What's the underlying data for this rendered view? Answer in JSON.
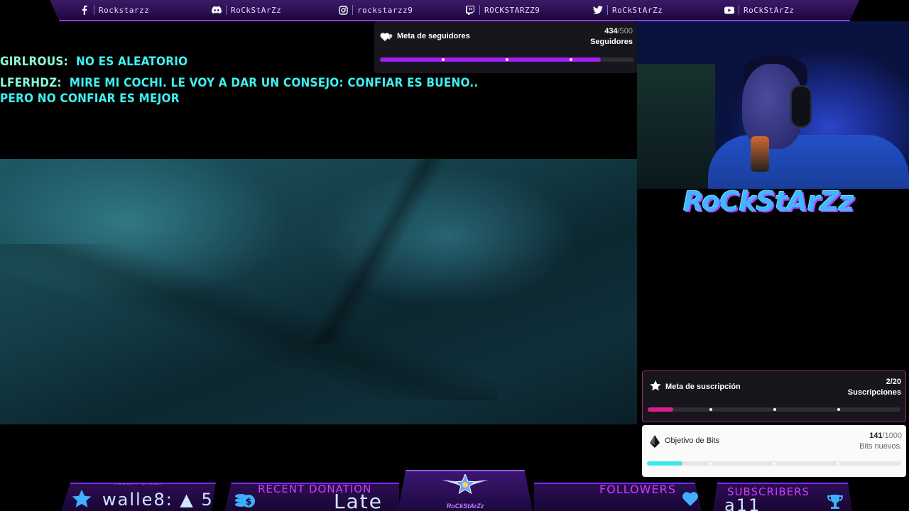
{
  "social": [
    {
      "icon": "facebook-icon",
      "handle": "Rockstarzz"
    },
    {
      "icon": "discord-icon",
      "handle": "RoCkStArZz"
    },
    {
      "icon": "instagram-icon",
      "handle": "rockstarzz9"
    },
    {
      "icon": "twitch-icon",
      "handle": "ROCKSTARZZ9"
    },
    {
      "icon": "twitter-icon",
      "handle": "RoCkStArZz"
    },
    {
      "icon": "youtube-icon",
      "handle": "RoCkStArZz"
    }
  ],
  "chat": [
    {
      "user": "GIRLROUS:",
      "message": "NO ES ALEATORIO"
    },
    {
      "user": "LFERHDZ:",
      "message": "MIRE MI COCHI. LE VOY A DAR UN CONSEJO: CONFIAR ES BUENO.."
    },
    {
      "user": "",
      "message": "PERO NO CONFIAR ES MEJOR"
    }
  ],
  "brand": {
    "logo_text": "RoCkStArZz",
    "emblem_label": "RoCkStArZz"
  },
  "goals": {
    "followers": {
      "title": "Meta de seguidores",
      "current": "434",
      "target": "/500",
      "unit": "Seguidores",
      "progress": 0.868,
      "color": "#a020f0"
    },
    "subs": {
      "title": "Meta de suscripción",
      "current": "2",
      "target": "/20",
      "unit": "Suscripciones",
      "progress": 0.1,
      "color": "#e01c8c"
    },
    "bits": {
      "title": "Objetivo de Bits",
      "current": "141",
      "target": "/1000",
      "unit": "Bits nuevos.",
      "progress": 0.141,
      "color": "#3fe6e6"
    }
  },
  "bottom": {
    "recent_cheer": {
      "tiny": "RECENT CHEER",
      "value": "walle8: ▲ 5"
    },
    "recent_donation": {
      "label": "RECENT DONATION",
      "value": "Late"
    },
    "followers": {
      "label": "FOLLOWERS"
    },
    "subscribers": {
      "label": "SUBSCRIBERS",
      "value": "a11"
    }
  },
  "colors": {
    "accent": "#8a3cff",
    "chat": "#3ff0f0",
    "label": "#d23cff"
  }
}
